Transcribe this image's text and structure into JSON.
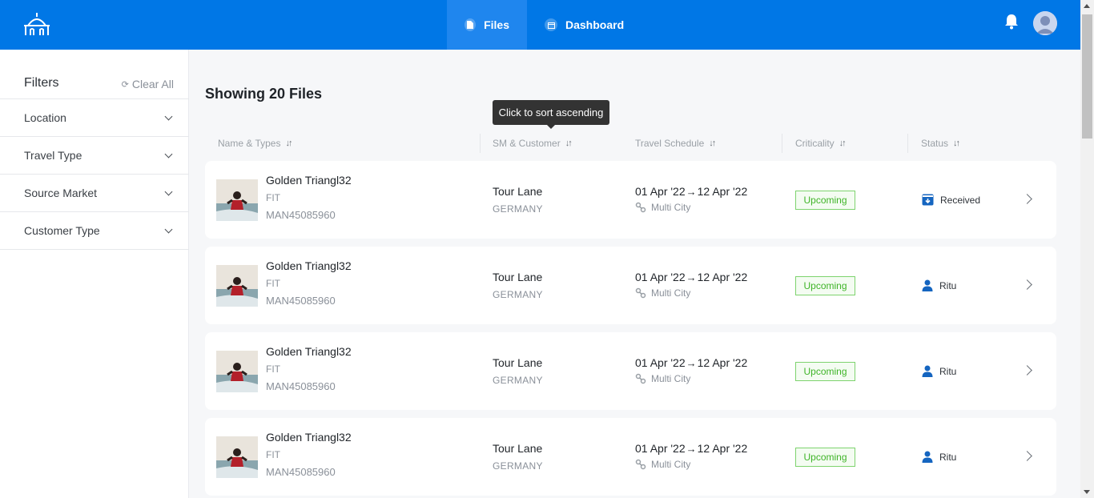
{
  "header": {
    "nav": [
      {
        "label": "Files",
        "icon": "file-icon",
        "active": true
      },
      {
        "label": "Dashboard",
        "icon": "calendar-icon",
        "active": false
      }
    ],
    "colors": {
      "brand": "#0077e6"
    }
  },
  "sidebar": {
    "title": "Filters",
    "clear_label": "Clear All",
    "filters": [
      "Location",
      "Travel Type",
      "Source Market",
      "Customer Type"
    ]
  },
  "main": {
    "title": "Showing 20 Files",
    "tooltip": "Click to sort ascending",
    "columns": [
      "Name & Types",
      "SM & Customer",
      "Travel Schedule",
      "Criticality",
      "Status"
    ],
    "rows": [
      {
        "name": "Golden Triangl32",
        "type": "FIT",
        "code": "MAN45085960",
        "customer": "Tour Lane",
        "country": "GERMANY",
        "start": "01 Apr '22",
        "end": "12 Apr '22",
        "route": "Multi City",
        "criticality": "Upcoming",
        "status": "Received",
        "status_icon": "inbox-icon"
      },
      {
        "name": "Golden Triangl32",
        "type": "FIT",
        "code": "MAN45085960",
        "customer": "Tour Lane",
        "country": "GERMANY",
        "start": "01 Apr '22",
        "end": "12 Apr '22",
        "route": "Multi City",
        "criticality": "Upcoming",
        "status": "Ritu",
        "status_icon": "user-icon"
      },
      {
        "name": "Golden Triangl32",
        "type": "FIT",
        "code": "MAN45085960",
        "customer": "Tour Lane",
        "country": "GERMANY",
        "start": "01 Apr '22",
        "end": "12 Apr '22",
        "route": "Multi City",
        "criticality": "Upcoming",
        "status": "Ritu",
        "status_icon": "user-icon"
      },
      {
        "name": "Golden Triangl32",
        "type": "FIT",
        "code": "MAN45085960",
        "customer": "Tour Lane",
        "country": "GERMANY",
        "start": "01 Apr '22",
        "end": "12 Apr '22",
        "route": "Multi City",
        "criticality": "Upcoming",
        "status": "Ritu",
        "status_icon": "user-icon"
      }
    ]
  }
}
